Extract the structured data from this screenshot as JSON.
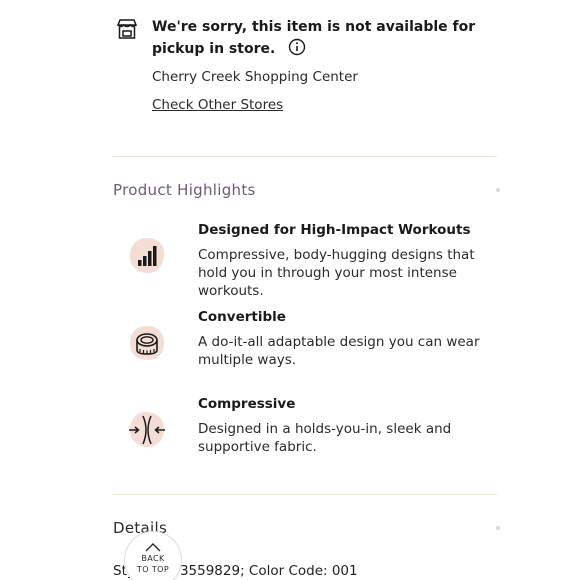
{
  "pickup": {
    "icon": "store-icon",
    "message": "We're sorry, this item is not available for pickup in store.",
    "info_icon": "info-icon",
    "store_name": "Cherry Creek Shopping Center",
    "check_link": "Check Other Stores"
  },
  "highlights": {
    "title": "Product Highlights",
    "items": [
      {
        "icon": "signal-bars-icon",
        "title": "Designed for High-Impact Workouts",
        "description": "Compressive, body-hugging designs that hold you in through your most intense workouts."
      },
      {
        "icon": "measuring-tape-icon",
        "title": "Convertible",
        "description": "A do-it-all adaptable design you can wear multiple ways."
      },
      {
        "icon": "compress-arrows-icon",
        "title": "Compressive",
        "description": "Designed in a holds-you-in, sleek and supportive fabric."
      }
    ]
  },
  "details": {
    "title": "Details",
    "style_line": "Style #: 63559829; Color Code: 001"
  },
  "back_to_top": {
    "line1": "BACK",
    "line2": "TO TOP"
  },
  "colors": {
    "accent_purple": "#6e5a7a",
    "icon_blob": "#f3ddd5",
    "divider": "#e9e4d6"
  }
}
